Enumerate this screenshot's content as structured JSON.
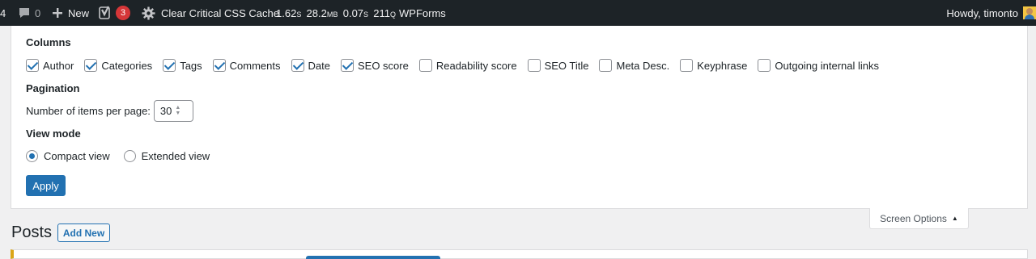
{
  "adminbar": {
    "partial_count": "4",
    "comments_count": "0",
    "new_label": "New",
    "yoast_badge": "3",
    "cache_label": "Clear Critical CSS Cache",
    "perf": {
      "time_value": "1.62",
      "time_unit": "S",
      "mem_value": "28.2",
      "mem_unit": "MB",
      "query_time_value": "0.07",
      "query_time_unit": "S",
      "queries_value": "211",
      "queries_unit": "Q"
    },
    "wpforms_label": "WPForms",
    "greeting": "Howdy, timonto"
  },
  "screen_options": {
    "columns_heading": "Columns",
    "columns": [
      {
        "label": "Author",
        "checked": true
      },
      {
        "label": "Categories",
        "checked": true
      },
      {
        "label": "Tags",
        "checked": true
      },
      {
        "label": "Comments",
        "checked": true
      },
      {
        "label": "Date",
        "checked": true
      },
      {
        "label": "SEO score",
        "checked": true
      },
      {
        "label": "Readability score",
        "checked": false
      },
      {
        "label": "SEO Title",
        "checked": false
      },
      {
        "label": "Meta Desc.",
        "checked": false
      },
      {
        "label": "Keyphrase",
        "checked": false
      },
      {
        "label": "Outgoing internal links",
        "checked": false
      }
    ],
    "pagination_heading": "Pagination",
    "items_per_page_label": "Number of items per page:",
    "items_per_page_value": "30",
    "view_mode_heading": "View mode",
    "view_modes": [
      {
        "label": "Compact view",
        "selected": true
      },
      {
        "label": "Extended view",
        "selected": false
      }
    ],
    "apply_label": "Apply",
    "tab_label": "Screen Options"
  },
  "page": {
    "title": "Posts",
    "add_new_label": "Add New"
  },
  "colors": {
    "accent": "#2271b1",
    "adminbar_bg": "#1d2327",
    "badge": "#d63638",
    "notice_border": "#dba617"
  }
}
